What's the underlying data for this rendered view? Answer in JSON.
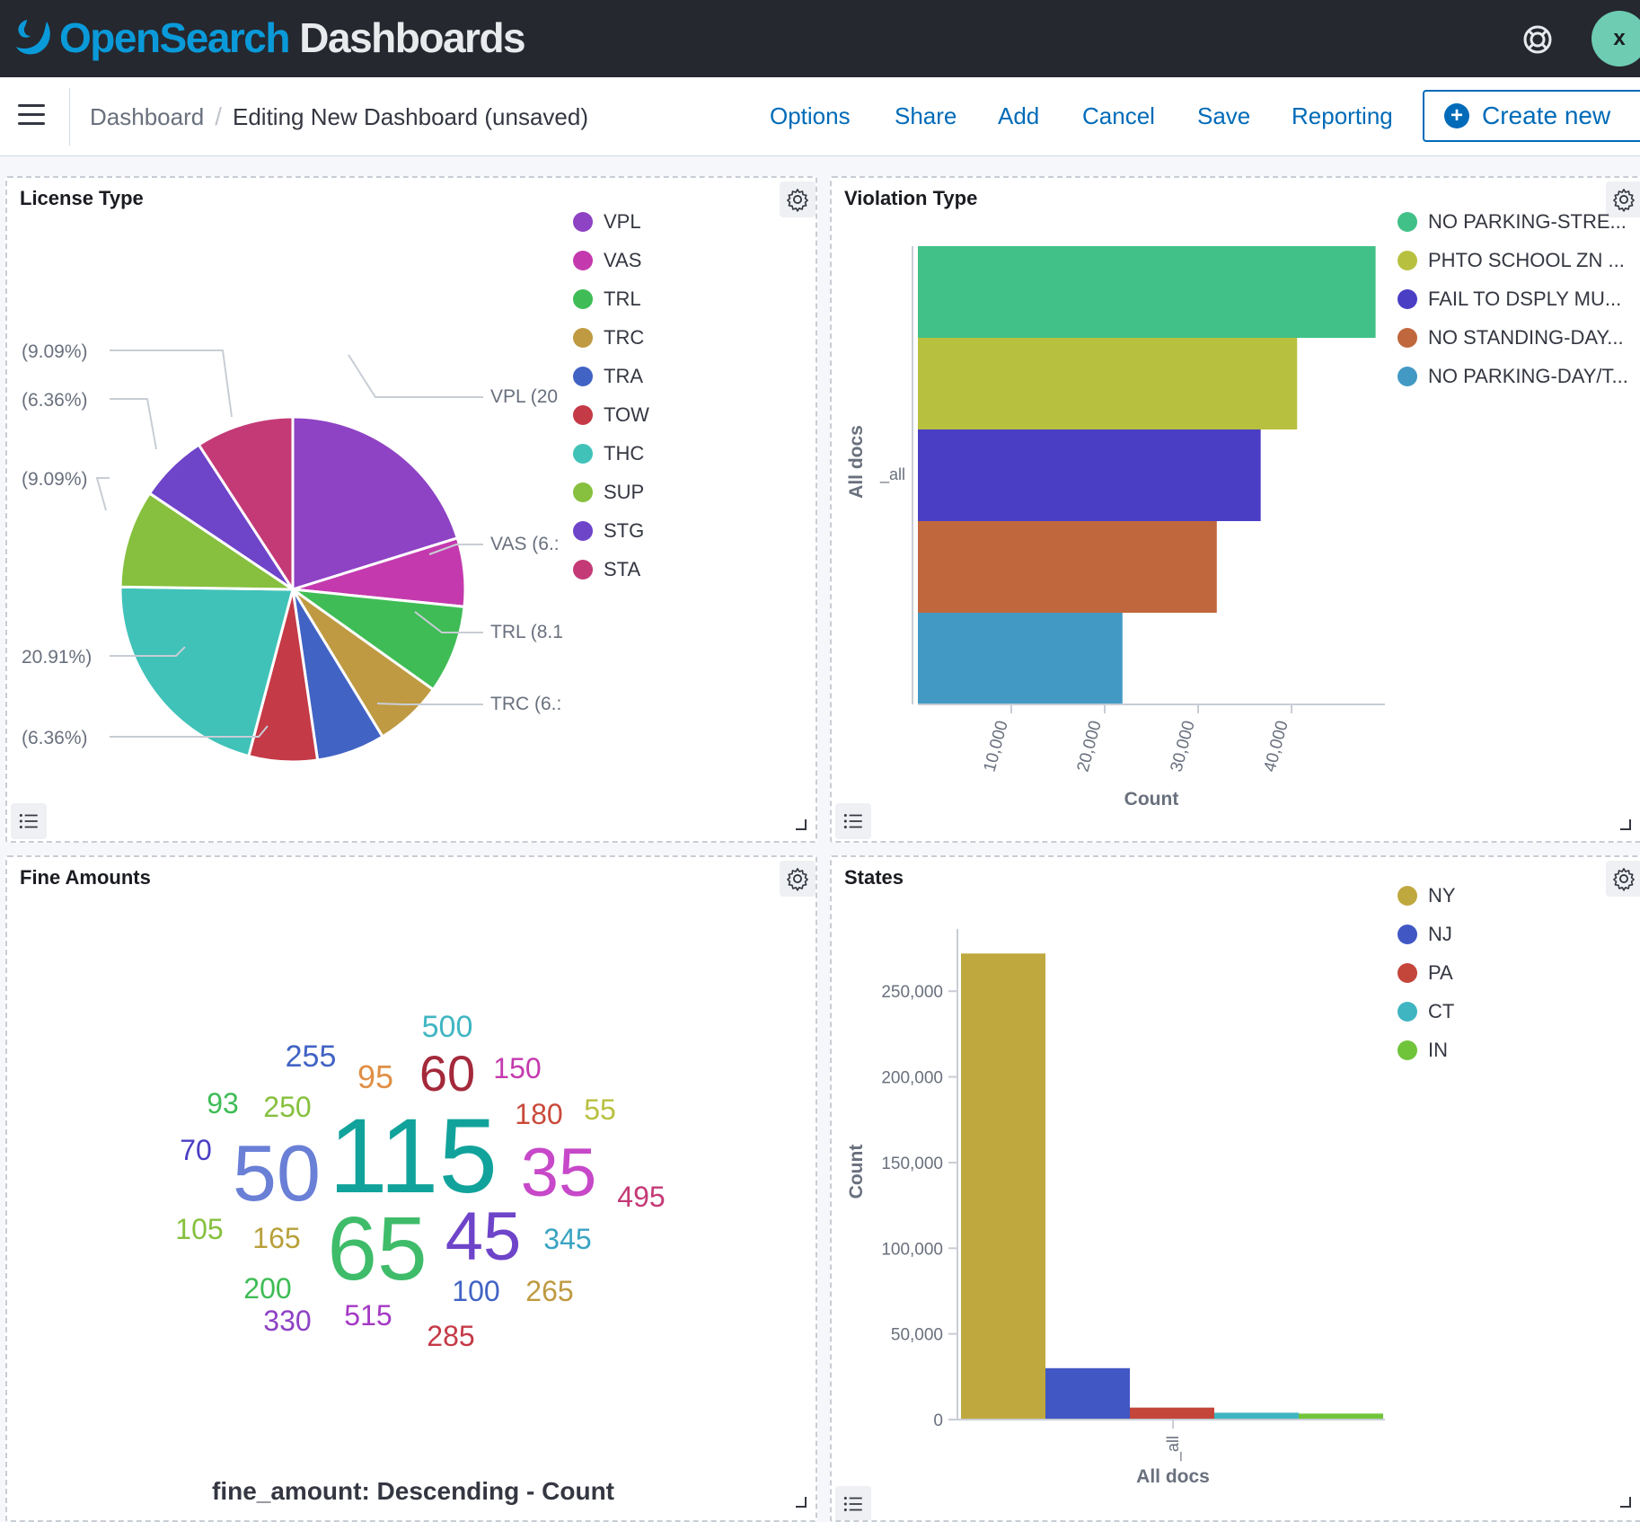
{
  "header": {
    "brand_first": "OpenSearch",
    "brand_second": "Dashboards",
    "avatar_initial": "x"
  },
  "nav": {
    "breadcrumb_root": "Dashboard",
    "breadcrumb_current": "Editing New Dashboard (unsaved)",
    "actions": [
      "Options",
      "Share",
      "Add",
      "Cancel",
      "Save",
      "Reporting"
    ],
    "create_new": "Create new"
  },
  "panels": {
    "license": {
      "title": "License Type",
      "legend": [
        {
          "name": "VPL",
          "color": "#8e42c4"
        },
        {
          "name": "VAS",
          "color": "#c43aae"
        },
        {
          "name": "TRL",
          "color": "#3fbc56"
        },
        {
          "name": "TRC",
          "color": "#bf9a42"
        },
        {
          "name": "TRA",
          "color": "#4163c4"
        },
        {
          "name": "TOW",
          "color": "#c43a46"
        },
        {
          "name": "THC",
          "color": "#40c2b8"
        },
        {
          "name": "SUP",
          "color": "#86c03e"
        },
        {
          "name": "STG",
          "color": "#6e44c9"
        },
        {
          "name": "STA",
          "color": "#c43a76"
        }
      ],
      "left_labels": [
        "(9.09%)",
        "(6.36%)",
        "(9.09%)",
        "20.91%)",
        "(6.36%)"
      ],
      "right_labels": [
        "VPL (20",
        "VAS (6.:",
        "TRL (8.1",
        "TRC (6.:"
      ]
    },
    "violation": {
      "title": "Violation Type",
      "legend": [
        {
          "name": "NO PARKING-STRE...",
          "color": "#41c087"
        },
        {
          "name": "PHTO SCHOOL ZN ...",
          "color": "#b8c13f"
        },
        {
          "name": "FAIL TO DSPLY MU...",
          "color": "#4a3ec4"
        },
        {
          "name": "NO STANDING-DAY...",
          "color": "#c0673d"
        },
        {
          "name": "NO PARKING-DAY/T...",
          "color": "#4299c4"
        }
      ]
    },
    "fine": {
      "title": "Fine Amounts",
      "caption": "fine_amount: Descending - Count",
      "words": [
        {
          "text": "500",
          "color": "#40b5c2"
        },
        {
          "text": "255",
          "color": "#4163c4"
        },
        {
          "text": "95",
          "color": "#e08f45"
        },
        {
          "text": "60",
          "color": "#a4293b"
        },
        {
          "text": "150",
          "color": "#c43aae"
        },
        {
          "text": "93",
          "color": "#3fbc56"
        },
        {
          "text": "250",
          "color": "#86c03e"
        },
        {
          "text": "180",
          "color": "#c94a3a"
        },
        {
          "text": "55",
          "color": "#b8c13f"
        },
        {
          "text": "70",
          "color": "#4a3ec4"
        },
        {
          "text": "50",
          "color": "#6a7fd6"
        },
        {
          "text": "115",
          "color": "#11a39b"
        },
        {
          "text": "35",
          "color": "#c748c9"
        },
        {
          "text": "495",
          "color": "#c43a76"
        },
        {
          "text": "105",
          "color": "#86c03e"
        },
        {
          "text": "165",
          "color": "#b8a03a"
        },
        {
          "text": "65",
          "color": "#3fbc6a"
        },
        {
          "text": "45",
          "color": "#6e44c9"
        },
        {
          "text": "345",
          "color": "#3aa4c2"
        },
        {
          "text": "200",
          "color": "#3fbc56"
        },
        {
          "text": "100",
          "color": "#4163c4"
        },
        {
          "text": "265",
          "color": "#bf9a42"
        },
        {
          "text": "330",
          "color": "#8e42c4"
        },
        {
          "text": "515",
          "color": "#a43ac4"
        },
        {
          "text": "285",
          "color": "#c43a46"
        }
      ]
    },
    "states": {
      "title": "States",
      "legend": [
        {
          "name": "NY",
          "color": "#bfa83e"
        },
        {
          "name": "NJ",
          "color": "#4157c4"
        },
        {
          "name": "PA",
          "color": "#c4453a"
        },
        {
          "name": "CT",
          "color": "#40b5c2"
        },
        {
          "name": "IN",
          "color": "#70c43a"
        }
      ]
    }
  },
  "chart_data": [
    {
      "type": "pie",
      "title": "License Type",
      "categories": [
        "VPL",
        "VAS",
        "TRL",
        "TRC",
        "TRA",
        "TOW",
        "THC",
        "SUP",
        "STG",
        "STA"
      ],
      "values": [
        20.0,
        6.36,
        8.18,
        6.36,
        6.36,
        6.36,
        20.91,
        9.09,
        6.36,
        9.09
      ],
      "unit": "percent"
    },
    {
      "type": "bar",
      "orientation": "horizontal",
      "title": "Violation Type",
      "categories": [
        "_all"
      ],
      "series": [
        {
          "name": "NO PARKING-STRE...",
          "values": [
            49000
          ]
        },
        {
          "name": "PHTO SCHOOL ZN ...",
          "values": [
            40600
          ]
        },
        {
          "name": "FAIL TO DSPLY MU...",
          "values": [
            36700
          ]
        },
        {
          "name": "NO STANDING-DAY...",
          "values": [
            32000
          ]
        },
        {
          "name": "NO PARKING-DAY/T...",
          "values": [
            21900
          ]
        }
      ],
      "xlabel": "Count",
      "ylabel": "All docs",
      "xlim": [
        0,
        50000
      ],
      "ticks": [
        10000,
        20000,
        30000,
        40000
      ],
      "tick_labels": [
        "10,000",
        "20,000",
        "30,000",
        "40,000"
      ],
      "legend": "right"
    },
    {
      "type": "wordcloud",
      "title": "Fine Amounts",
      "caption": "fine_amount: Descending - Count",
      "words": [
        "115",
        "65",
        "50",
        "35",
        "45",
        "60",
        "500",
        "255",
        "95",
        "150",
        "93",
        "250",
        "180",
        "55",
        "70",
        "495",
        "105",
        "165",
        "345",
        "200",
        "100",
        "265",
        "330",
        "515",
        "285"
      ],
      "weights": [
        100,
        84,
        63,
        55,
        55,
        43,
        30,
        30,
        33,
        28,
        28,
        28,
        28,
        28,
        28,
        28,
        28,
        28,
        28,
        28,
        28,
        28,
        28,
        28,
        28
      ]
    },
    {
      "type": "bar",
      "title": "States",
      "categories": [
        "_all"
      ],
      "series": [
        {
          "name": "NY",
          "values": [
            272000
          ]
        },
        {
          "name": "NJ",
          "values": [
            30000
          ]
        },
        {
          "name": "PA",
          "values": [
            7000
          ]
        },
        {
          "name": "CT",
          "values": [
            4000
          ]
        },
        {
          "name": "IN",
          "values": [
            3500
          ]
        }
      ],
      "xlabel": "All docs",
      "ylabel": "Count",
      "ylim": [
        0,
        280000
      ],
      "ticks": [
        0,
        50000,
        100000,
        150000,
        200000,
        250000
      ],
      "tick_labels": [
        "0",
        "50,000",
        "100,000",
        "150,000",
        "200,000",
        "250,000"
      ],
      "legend": "right"
    }
  ]
}
